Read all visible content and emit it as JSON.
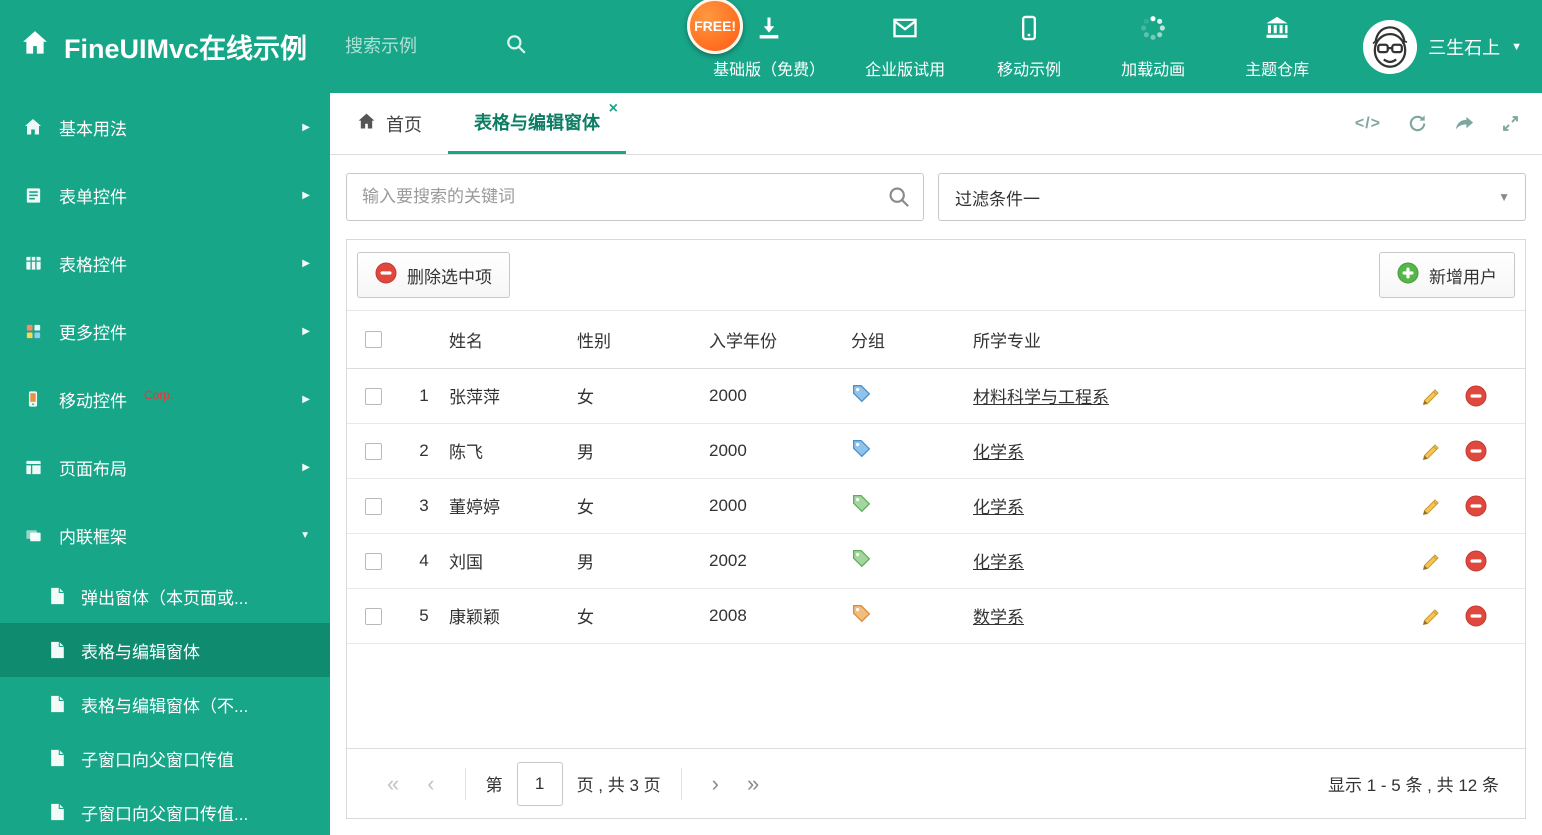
{
  "header": {
    "title": "FineUIMvc在线示例",
    "search_placeholder": "搜索示例",
    "free_badge": "FREE!",
    "nav": [
      {
        "id": "basic-free",
        "label": "基础版（免费）",
        "icon": "download-icon"
      },
      {
        "id": "enterprise",
        "label": "企业版试用",
        "icon": "mail-icon"
      },
      {
        "id": "mobile-demo",
        "label": "移动示例",
        "icon": "mobile-icon"
      },
      {
        "id": "loading-anim",
        "label": "加载动画",
        "icon": "spinner-icon"
      },
      {
        "id": "theme-store",
        "label": "主题仓库",
        "icon": "bank-icon"
      }
    ],
    "user": {
      "name": "三生石上"
    }
  },
  "sidebar": {
    "items": [
      {
        "id": "basic-usage",
        "label": "基本用法",
        "icon": "home-icon",
        "iconKey": "home",
        "expanded": false
      },
      {
        "id": "form-controls",
        "label": "表单控件",
        "icon": "form-icon",
        "iconKey": "form",
        "expanded": false
      },
      {
        "id": "grid-controls",
        "label": "表格控件",
        "icon": "table-icon",
        "iconKey": "grid",
        "expanded": false
      },
      {
        "id": "more-controls",
        "label": "更多控件",
        "icon": "blocks-icon",
        "iconKey": "more",
        "expanded": false
      },
      {
        "id": "mobile-controls",
        "label": "移动控件",
        "icon": "mobile-icon",
        "iconKey": "mobile",
        "badge": "Corp.",
        "expanded": false
      },
      {
        "id": "page-layout",
        "label": "页面布局",
        "icon": "layout-icon",
        "iconKey": "layout",
        "expanded": false
      },
      {
        "id": "inline-frame",
        "label": "内联框架",
        "icon": "frame-icon",
        "iconKey": "frame",
        "expanded": true
      }
    ],
    "subitems": [
      {
        "id": "popup-window",
        "label": "弹出窗体（本页面或...",
        "active": false
      },
      {
        "id": "grid-edit-window",
        "label": "表格与编辑窗体",
        "active": true
      },
      {
        "id": "grid-edit-window-2",
        "label": "表格与编辑窗体（不...",
        "active": false
      },
      {
        "id": "child-to-parent",
        "label": "子窗口向父窗口传值",
        "active": false
      },
      {
        "id": "child-to-parent-2",
        "label": "子窗口向父窗口传值...",
        "active": false
      }
    ]
  },
  "tabs": {
    "home": "首页",
    "active": "表格与编辑窗体",
    "close_glyph": "×"
  },
  "filters": {
    "search_placeholder": "输入要搜索的关键词",
    "filter_value": "过滤条件一"
  },
  "toolbar": {
    "delete_label": "删除选中项",
    "add_label": "新增用户"
  },
  "table": {
    "columns": [
      "姓名",
      "性别",
      "入学年份",
      "分组",
      "所学专业"
    ],
    "rows": [
      {
        "index": "1",
        "name": "张萍萍",
        "gender": "女",
        "year": "2000",
        "tag_fill": "#8fc3ec",
        "tag_stroke": "#4a90c8",
        "major": "材料科学与工程系"
      },
      {
        "index": "2",
        "name": "陈飞",
        "gender": "男",
        "year": "2000",
        "tag_fill": "#8fc3ec",
        "tag_stroke": "#4a90c8",
        "major": "化学系"
      },
      {
        "index": "3",
        "name": "董婷婷",
        "gender": "女",
        "year": "2000",
        "tag_fill": "#a3d69f",
        "tag_stroke": "#5fae5c",
        "major": "化学系"
      },
      {
        "index": "4",
        "name": "刘国",
        "gender": "男",
        "year": "2002",
        "tag_fill": "#a3d69f",
        "tag_stroke": "#5fae5c",
        "major": "化学系"
      },
      {
        "index": "5",
        "name": "康颖颖",
        "gender": "女",
        "year": "2008",
        "tag_fill": "#f4bc7c",
        "tag_stroke": "#d98a3d",
        "major": "数学系"
      }
    ]
  },
  "pagination": {
    "first": "«",
    "prev": "‹",
    "next": "›",
    "last": "»",
    "prefix": "第",
    "current": "1",
    "suffix": "页 , 共 3 页",
    "summary": "显示 1 - 5 条 , 共 12 条"
  },
  "colors": {
    "primary": "#18a689",
    "sidebar_active": "#0f8b70",
    "free_badge": "#ff5a12",
    "delete_red": "#e0473d",
    "add_green": "#55b649",
    "pencil_yellow": "#f6c552"
  }
}
